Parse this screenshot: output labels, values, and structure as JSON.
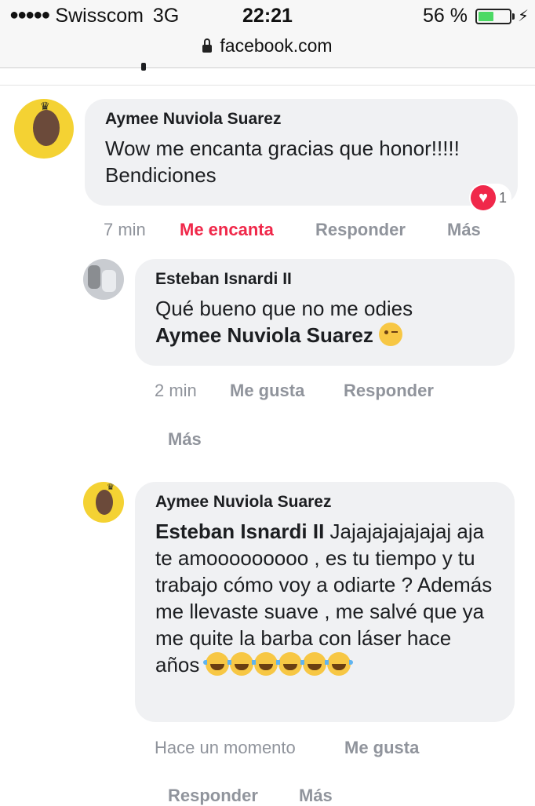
{
  "status_bar": {
    "carrier": "Swisscom",
    "network": "3G",
    "time": "22:21",
    "battery_percent": "56 %",
    "battery_level": 0.56
  },
  "browser": {
    "url": "facebook.com"
  },
  "comments": [
    {
      "author": "Aymee Nuviola Suarez",
      "text": "Wow me encanta gracias que honor!!!!! Bendiciones",
      "reaction": {
        "icon": "heart-icon",
        "count": "1",
        "color": "#f0284a"
      },
      "time": "7 min",
      "like_label": "Me encanta",
      "reply_label": "Responder",
      "more_label": "Más"
    },
    {
      "author": "Esteban Isnardi II",
      "text": "Qué bueno que no me odies",
      "mention": "Aymee Nuviola Suarez",
      "emoji": "wink-emoji",
      "time": "2 min",
      "like_label": "Me gusta",
      "reply_label": "Responder",
      "more_label": "Más"
    },
    {
      "author": "Aymee Nuviola Suarez",
      "mention": "Esteban Isnardi II",
      "text": "Jajajajajajajaj aja te amooooooooo , es tu tiempo y tu trabajo cómo voy a odiarte ? Además me llevaste suave , me salvé que ya me quite la barba con láser hace años",
      "emoji": "tears-of-joy-emoji",
      "emoji_count": 6,
      "time": "Hace un momento",
      "like_label": "Me gusta",
      "reply_label": "Responder",
      "more_label": "Más"
    }
  ],
  "colors": {
    "bubble": "#f0f1f3",
    "love_action": "#f0284a",
    "action_text": "#90949c"
  }
}
